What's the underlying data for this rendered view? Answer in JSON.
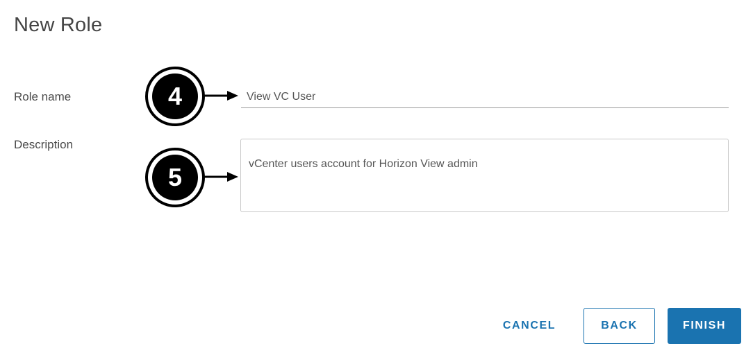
{
  "dialog": {
    "title": "New Role"
  },
  "form": {
    "role_name": {
      "label": "Role name",
      "value": "View VC User"
    },
    "description": {
      "label": "Description",
      "value": "vCenter users account for Horizon View admin"
    }
  },
  "callouts": [
    {
      "number": "4",
      "icon": "arrow-right-icon"
    },
    {
      "number": "5",
      "icon": "arrow-right-icon"
    }
  ],
  "footer": {
    "cancel_label": "CANCEL",
    "back_label": "BACK",
    "finish_label": "FINISH"
  },
  "colors": {
    "accent": "#1a73b0",
    "callout": "#000000"
  }
}
